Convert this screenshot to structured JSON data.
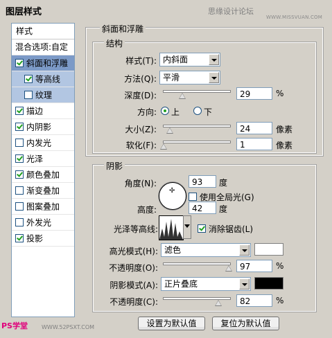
{
  "window": {
    "title": "图层样式",
    "watermark_cn": "思缘设计论坛",
    "watermark_url": "WWW.MISSVUAN.COM",
    "footer_logo": "PS学堂",
    "footer_url": "WWW.52PSXT.COM"
  },
  "sidebar": {
    "header": "样式",
    "blend_options": "混合选项:自定",
    "items": [
      {
        "label": "斜面和浮雕",
        "checked": true
      },
      {
        "label": "等高线",
        "checked": true
      },
      {
        "label": "纹理",
        "checked": false
      },
      {
        "label": "描边",
        "checked": true
      },
      {
        "label": "内阴影",
        "checked": true
      },
      {
        "label": "内发光",
        "checked": false
      },
      {
        "label": "光泽",
        "checked": true
      },
      {
        "label": "颜色叠加",
        "checked": true
      },
      {
        "label": "渐变叠加",
        "checked": false
      },
      {
        "label": "图案叠加",
        "checked": false
      },
      {
        "label": "外发光",
        "checked": false
      },
      {
        "label": "投影",
        "checked": true
      }
    ]
  },
  "bevel": {
    "title": "斜面和浮雕",
    "structure_title": "结构",
    "style_label": "样式(T):",
    "style_value": "内斜面",
    "technique_label": "方法(Q):",
    "technique_value": "平滑",
    "depth_label": "深度(D):",
    "depth_value": "29",
    "depth_unit": "%",
    "depth_level": 29,
    "direction_label": "方向:",
    "direction_up": "上",
    "direction_down": "下",
    "size_label": "大小(Z):",
    "size_value": "24",
    "size_unit": "像素",
    "size_level": 10,
    "soften_label": "软化(F):",
    "soften_value": "1",
    "soften_unit": "像素",
    "soften_level": 1
  },
  "shading": {
    "title": "阴影",
    "angle_label": "角度(N):",
    "angle_value": "93",
    "angle_unit": "度",
    "global_light_label": "使用全局光(G)",
    "global_light": false,
    "altitude_label": "高度:",
    "altitude_value": "42",
    "altitude_unit": "度",
    "gloss_label": "光泽等高线:",
    "antialias_label": "消除锯齿(L)",
    "antialias": true,
    "highlight_mode_label": "高光模式(H):",
    "highlight_mode_value": "滤色",
    "highlight_color": "#ffffff",
    "highlight_opacity_label": "不透明度(O):",
    "highlight_opacity_value": "97",
    "highlight_opacity_unit": "%",
    "highlight_opacity_level": 97,
    "shadow_mode_label": "阴影模式(A):",
    "shadow_mode_value": "正片叠底",
    "shadow_color": "#000000",
    "shadow_opacity_label": "不透明度(C):",
    "shadow_opacity_value": "82",
    "shadow_opacity_unit": "%",
    "shadow_opacity_level": 82
  },
  "buttons": {
    "make_default": "设置为默认值",
    "reset_default": "复位为默认值"
  }
}
